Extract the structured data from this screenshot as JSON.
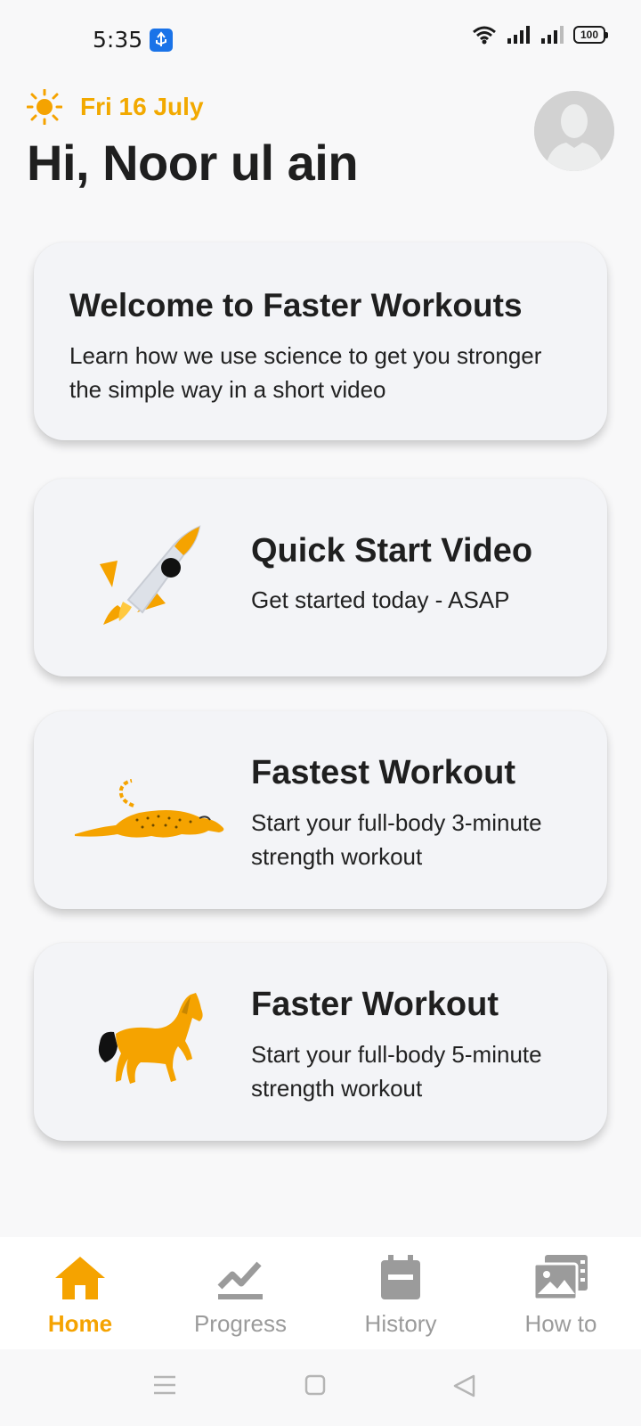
{
  "status_bar": {
    "time": "5:35",
    "battery": "100",
    "icons": [
      "usb-debug-icon",
      "wifi-icon",
      "signal-icon",
      "signal-icon",
      "battery-icon"
    ]
  },
  "header": {
    "date": "Fri 16 July",
    "greeting": "Hi, Noor ul ain",
    "weather_icon": "sun-icon",
    "avatar_icon": "profile-avatar"
  },
  "cards": {
    "welcome": {
      "title": "Welcome to Faster Workouts",
      "description": "Learn how we use science to get you stronger the simple way in a short video"
    },
    "quick_start": {
      "icon": "rocket-icon",
      "title": "Quick Start Video",
      "description": "Get started today - ASAP"
    },
    "fastest": {
      "icon": "cheetah-icon",
      "title": "Fastest Workout",
      "description": "Start your full-body 3-minute strength workout"
    },
    "faster": {
      "icon": "horse-icon",
      "title": "Faster Workout",
      "description": "Start your full-body 5-minute strength workout"
    }
  },
  "bottom_nav": {
    "items": [
      {
        "label": "Home",
        "icon": "home-icon",
        "active": true
      },
      {
        "label": "Progress",
        "icon": "progress-icon",
        "active": false
      },
      {
        "label": "History",
        "icon": "calendar-icon",
        "active": false
      },
      {
        "label": "How to",
        "icon": "video-library-icon",
        "active": false
      }
    ]
  },
  "colors": {
    "accent": "#f5a300",
    "card_bg": "#f3f4f7",
    "inactive": "#9b9b9b"
  }
}
